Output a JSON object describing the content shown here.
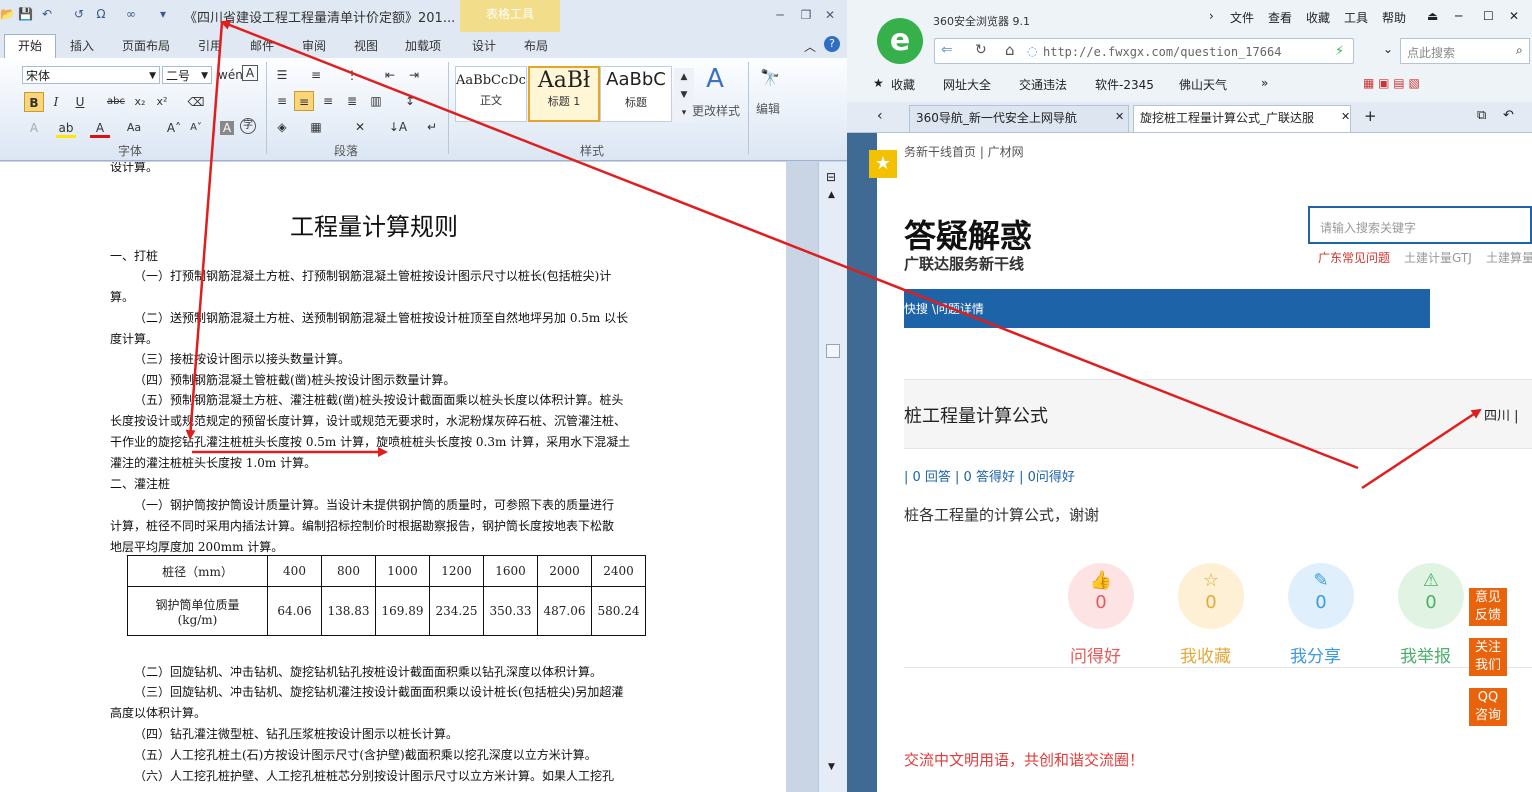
{
  "word": {
    "doc_title": "《四川省建设工程工程量清单计价定额》201...",
    "table_tools": "表格工具",
    "tabs": [
      "开始",
      "插入",
      "页面布局",
      "引用",
      "邮件",
      "审阅",
      "视图",
      "加载项",
      "设计",
      "布局"
    ],
    "font_name": "宋体",
    "font_size": "二号",
    "group_font": "字体",
    "group_paragraph": "段落",
    "group_styles": "样式",
    "styles": [
      {
        "sample": "AaBbCcDc",
        "name": "正文"
      },
      {
        "sample": "AaBł",
        "name": "标题 1"
      },
      {
        "sample": "AaBbC",
        "name": "标题"
      }
    ],
    "change_styles": "更改样式",
    "editing": "编辑",
    "doc": {
      "top_fragment": "设计算。",
      "heading": "工程量计算规则",
      "lines": [
        "一、打桩",
        "（一）打预制钢筋混凝土方桩、打预制钢筋混凝土管桩按设计图示尺寸以桩长(包括桩尖)计",
        "算。",
        "（二）送预制钢筋混凝土方桩、送预制钢筋混凝土管桩按设计桩顶至自然地坪另加 0.5m 以长",
        "度计算。",
        "（三）接桩按设计图示以接头数量计算。",
        "（四）预制钢筋混凝土管桩截(凿)桩头按设计图示数量计算。",
        "（五）预制钢筋混凝土方桩、灌注桩截(凿)桩头按设计截面面乘以桩头长度以体积计算。桩头",
        "长度按设计或规范规定的预留长度计算，设计或规范无要求时，水泥粉煤灰碎石桩、沉管灌注桩、",
        "干作业的旋挖钻孔灌注桩桩头长度按 0.5m 计算，旋喷桩桩头长度按 0.3m 计算，采用水下混凝土",
        "灌注的灌注桩桩头长度按 1.0m 计算。",
        "二、灌注桩",
        "（一）钢护筒按护筒设计质量计算。当设计未提供钢护筒的质量时，可参照下表的质量进行",
        "计算，桩径不同时采用内插法计算。编制招标控制价时根据勘察报告，钢护筒长度按地表下松散",
        "地层平均厚度加 200mm 计算。"
      ],
      "table": {
        "row1_header": "桩径（mm）",
        "diameters": [
          "400",
          "800",
          "1000",
          "1200",
          "1600",
          "2000",
          "2400"
        ],
        "row2_header_line1": "钢护筒单位质量",
        "row2_header_line2": "(kg/m)",
        "weights": [
          "64.06",
          "138.83",
          "169.89",
          "234.25",
          "350.33",
          "487.06",
          "580.24"
        ]
      },
      "lines2": [
        "（二）回旋钻机、冲击钻机、旋挖钻机钻孔按桩设计截面面积乘以钻孔深度以体积计算。",
        "（三）回旋钻机、冲击钻机、旋挖钻机灌注按设计截面面积乘以设计桩长(包括桩尖)另加超灌",
        "高度以体积计算。",
        "（四）钻孔灌注微型桩、钻孔压浆桩按设计图示以桩长计算。",
        "（五）人工挖孔桩土(石)方按设计图示尺寸(含护壁)截面积乘以挖孔深度以立方米计算。",
        "（六）人工挖孔桩护壁、人工挖孔桩桩芯分别按设计图示尺寸以立方米计算。如果人工挖孔"
      ]
    }
  },
  "browser": {
    "name": "360安全浏览器 9.1",
    "menu": [
      "文件",
      "查看",
      "收藏",
      "工具",
      "帮助"
    ],
    "url": "http://e.fwxgx.com/question_17664",
    "search_placeholder": "点此搜索",
    "favorites": [
      "收藏",
      "网址大全",
      "交通违法",
      "软件-2345",
      "佛山天气"
    ],
    "tabs": [
      "360导航_新一代安全上网导航",
      "旋挖桩工程量计算公式_广联达服"
    ],
    "site": {
      "nav": "务新干线首页 | 广材网",
      "h1": "答疑解惑",
      "subtitle": "广联达服务新干线",
      "search_placeholder": "请输入搜索关键字",
      "hotlinks": [
        "广东常见问题",
        "土建计量GTJ",
        "土建算量"
      ],
      "bar_text": "快搜 \\问题详情",
      "question_title": "桩工程量计算公式",
      "location": "四川 |",
      "stats": "| 0 回答 | 0 答得好 | 0问得好",
      "body": "桩各工程量的计算公式，谢谢",
      "actions": [
        {
          "icon": "👍",
          "count": "0",
          "label": "问得好",
          "color": "#e55b5b",
          "bg": "#fde3e3"
        },
        {
          "icon": "☆",
          "count": "0",
          "label": "我收藏",
          "color": "#e4a93c",
          "bg": "#fdf0d4"
        },
        {
          "icon": "✎",
          "count": "0",
          "label": "我分享",
          "color": "#3d9be0",
          "bg": "#dff0fc"
        },
        {
          "icon": "⚠",
          "count": "0",
          "label": "我举报",
          "color": "#4caf6a",
          "bg": "#e1f4e4"
        }
      ],
      "notice": "交流中文明用语，共创和谐交流圈！",
      "float_buttons": [
        [
          "意见",
          "反馈"
        ],
        [
          "关注",
          "我们"
        ],
        [
          "QQ",
          "咨询"
        ]
      ]
    }
  },
  "colors": {
    "annotation": "#e01e1e",
    "brand_blue": "#1c63a8",
    "float_orange": "#e8630c"
  }
}
